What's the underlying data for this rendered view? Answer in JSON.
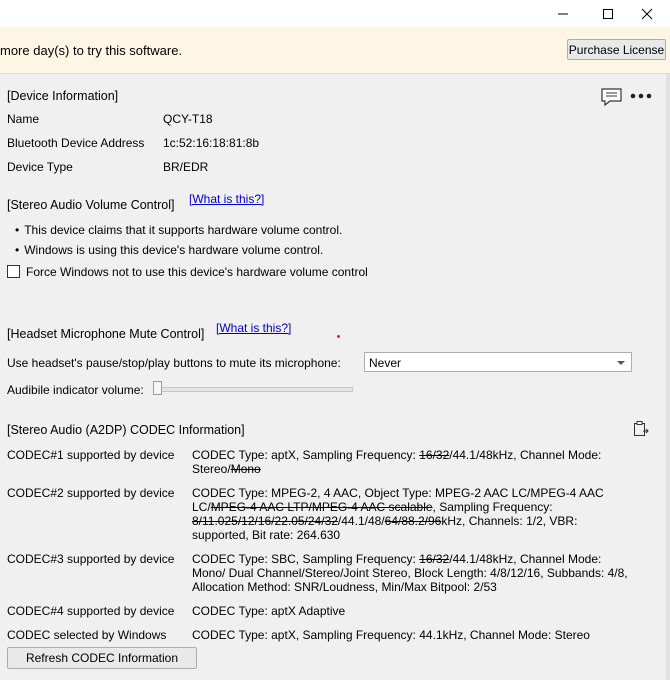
{
  "window": {
    "minimize_icon": "minimize-icon",
    "maximize_icon": "maximize-icon",
    "close_icon": "close-icon"
  },
  "banner": {
    "text": "more day(s) to try this software.",
    "purchase_label": "Purchase License"
  },
  "device_info": {
    "heading": "[Device Information]",
    "rows": [
      {
        "label": "Name",
        "value": "QCY-T18"
      },
      {
        "label": "Bluetooth Device Address",
        "value": "1c:52:16:18:81:8b"
      },
      {
        "label": "Device Type",
        "value": "BR/EDR"
      }
    ]
  },
  "toolbar_icons": {
    "chat": "chat-bubble-icon",
    "more": "more-options-icon",
    "clipboard": "clipboard-icon"
  },
  "volume": {
    "heading": "[Stereo Audio Volume Control]",
    "link": "[What is this?]",
    "bullets": [
      "This device claims that it supports hardware volume control.",
      "Windows is using this device's hardware volume control."
    ],
    "checkbox_label": "Force Windows not to use this device's hardware volume control",
    "checked": false
  },
  "mic": {
    "heading": "[Headset Microphone Mute Control]",
    "link": "[What is this?]",
    "select_label": "Use headset's pause/stop/play buttons to mute its microphone:",
    "select_value": "Never",
    "slider_label": "Audibile indicator volume:",
    "slider_value": 0
  },
  "codec": {
    "heading": "[Stereo Audio (A2DP) CODEC Information]",
    "rows": [
      {
        "name": "CODEC#1 supported by device",
        "parts": [
          "CODEC Type: aptX, Sampling Frequency: ",
          "16/32",
          "/44.1/48kHz, Channel Mode: Stereo/",
          "Mono"
        ]
      },
      {
        "name": "CODEC#2 supported by device",
        "parts": [
          "CODEC Type: MPEG-2, 4 AAC, Object Type: MPEG-2 AAC LC/MPEG-4 AAC LC/",
          "MPEG-4 AAC LTP/MPEG-4 AAC scalable",
          ", Sampling Frequency: ",
          "8/11.025/12/16/22.05/24/32",
          "/44.1/48/",
          "64/88.2/96",
          "kHz, Channels: 1/2, VBR: supported, Bit rate: 264.630"
        ]
      },
      {
        "name": "CODEC#3 supported by device",
        "parts": [
          "CODEC Type: SBC, Sampling Frequency: ",
          "16/32",
          "/44.1/48kHz, Channel Mode: Mono/ Dual Channel/Stereo/Joint Stereo, Block Length: 4/8/12/16, Subbands: 4/8, Allocation Method: SNR/Loudness, Min/Max Bitpool: 2/53"
        ]
      },
      {
        "name": "CODEC#4 supported by device",
        "parts": [
          "CODEC Type: aptX Adaptive"
        ]
      },
      {
        "name": "CODEC selected by Windows",
        "parts": [
          "CODEC Type: aptX, Sampling Frequency: 44.1kHz, Channel Mode: Stereo"
        ]
      }
    ],
    "refresh_label": "Refresh CODEC Information"
  }
}
